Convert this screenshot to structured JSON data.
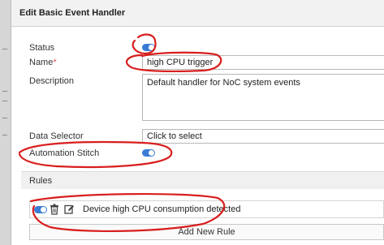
{
  "dialog": {
    "title": "Edit Basic Event Handler"
  },
  "form": {
    "status_label": "Status",
    "status_on": true,
    "name_label": "Name",
    "name_required_mark": "*",
    "name_value": "high CPU trigger",
    "description_label": "Description",
    "description_value": "Default handler for NoC system events",
    "data_selector_label": "Data Selector",
    "data_selector_value": "Click to select",
    "automation_stitch_label": "Automation Stitch",
    "automation_stitch_on": true
  },
  "rules": {
    "header": "Rules",
    "items": [
      {
        "enabled": true,
        "text": "Device high CPU consumption detected"
      }
    ],
    "add_button_label": "Add New Rule"
  },
  "icons": [
    "toggle-icon",
    "trash-icon",
    "edit-icon"
  ],
  "colors": {
    "toggle_on": "#3a7bd5",
    "annotation": "#d81e1e",
    "required": "#d9534f"
  }
}
